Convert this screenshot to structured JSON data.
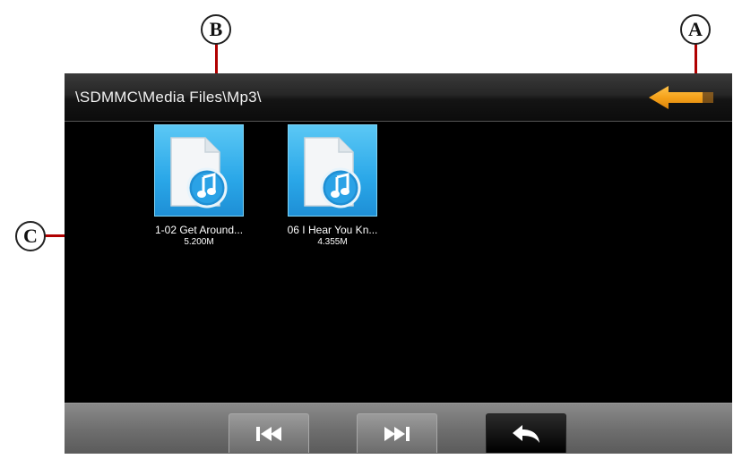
{
  "path_bar": {
    "path": "\\SDMMC\\Media Files\\Mp3\\",
    "back_icon": "orange-left-arrow-icon"
  },
  "files": [
    {
      "name": "1-02 Get Around...",
      "size": "5.200M",
      "icon": "music-file-icon"
    },
    {
      "name": "06 I Hear You Kn...",
      "size": "4.355M",
      "icon": "music-file-icon"
    }
  ],
  "toolbar": {
    "buttons": [
      {
        "icon": "skip-previous-icon"
      },
      {
        "icon": "skip-next-icon"
      },
      {
        "icon": "return-icon"
      }
    ]
  },
  "callouts": {
    "a": "A",
    "b": "B",
    "c": "C"
  },
  "colors": {
    "accent_arrow": "#f5a21b",
    "thumb_blue": "#2aa7e8",
    "callout_line": "#b00000"
  }
}
